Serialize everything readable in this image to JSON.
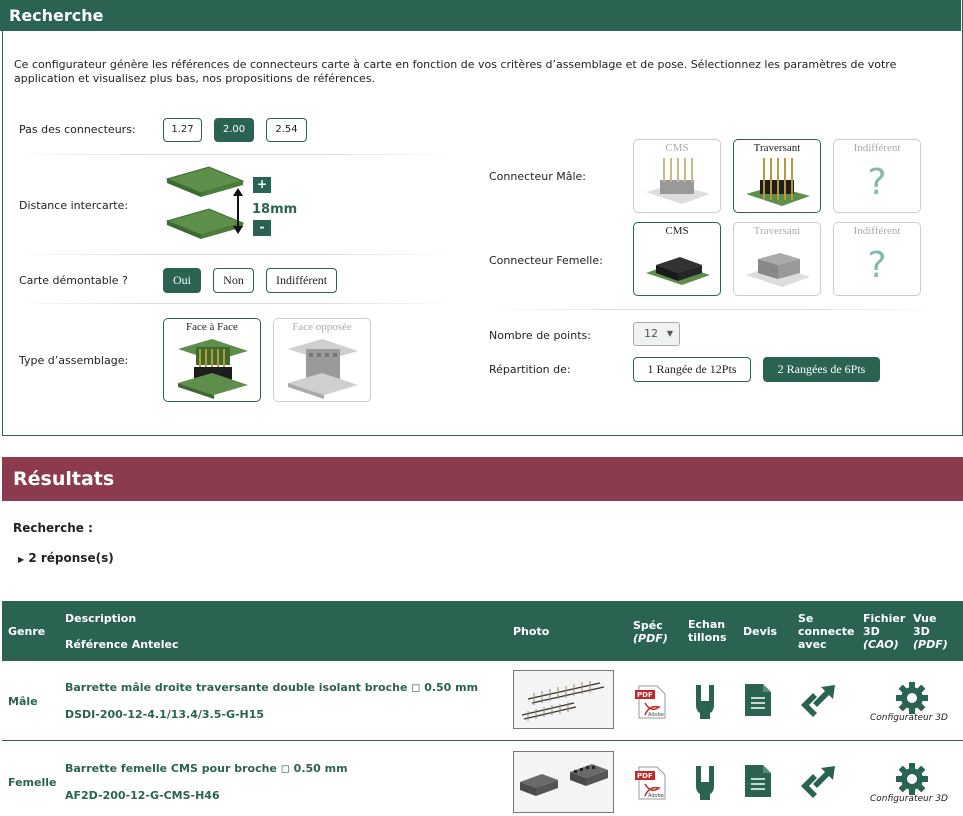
{
  "recherche": {
    "title": "Recherche",
    "intro": "Ce configurateur génère les références de connecteurs carte à carte en fonction de vos critères d’assemblage et de pose. Sélectionnez les paramètres de votre application et visualisez plus bas, nos propositions de références.",
    "pas": {
      "label": "Pas des connecteurs:",
      "options": [
        "1.27",
        "2.00",
        "2.54"
      ],
      "selected": "2.00"
    },
    "distance": {
      "label": "Distance intercarte:",
      "value": "18mm",
      "plus": "+",
      "minus": "-"
    },
    "demontable": {
      "label": "Carte démontable ?",
      "options": [
        "Oui",
        "Non",
        "Indifférent"
      ],
      "selected": "Oui"
    },
    "assemblage": {
      "label": "Type d’assemblage:",
      "options": [
        "Face à Face",
        "Face opposée"
      ],
      "selected": "Face à Face"
    },
    "male": {
      "label": "Connecteur Mâle:",
      "options": [
        "CMS",
        "Traversant",
        "Indifférent"
      ],
      "selected": "Traversant"
    },
    "femelle": {
      "label": "Connecteur Femelle:",
      "options": [
        "CMS",
        "Traversant",
        "Indifférent"
      ],
      "selected": "CMS"
    },
    "points": {
      "label": "Nombre de points:",
      "value": "12"
    },
    "repartition": {
      "label": "Répartition de:",
      "options": [
        "1 Rangée de 12Pts",
        "2 Rangées de 6Pts"
      ],
      "selected": "2 Rangées de 6Pts"
    },
    "question_mark": "?"
  },
  "resultats": {
    "title": "Résultats",
    "recherche_label": "Recherche :",
    "responses": "2 réponse(s)",
    "columns": {
      "genre": "Genre",
      "description": "Description",
      "reference": "Référence Antelec",
      "photo": "Photo",
      "spec": "Spéc",
      "spec_sub": "(PDF)",
      "echan": "Echan",
      "echan2": "tillons",
      "devis": "Devis",
      "connecte1": "Se",
      "connecte2": "connecte",
      "connecte3": "avec",
      "fichier1": "Fichier",
      "fichier2": "3D",
      "fichier3": "(CAO)",
      "vue1": "Vue",
      "vue2": "3D",
      "vue3": "(PDF)"
    },
    "rows": [
      {
        "genre": "Mâle",
        "description": "Barrette mâle droite traversante double isolant broche ◻ 0.50 mm",
        "reference": "DSDI-200-12-4.1/13.4/3.5-G-H15",
        "config_label": "Configurateur 3D"
      },
      {
        "genre": "Femelle",
        "description": "Barrette femelle CMS pour broche ◻ 0.50 mm",
        "reference": "AF2D-200-12-G-CMS-H46",
        "config_label": "Configurateur 3D"
      }
    ],
    "pdf_label": "PDF",
    "adobe_label": "Adobe"
  },
  "colors": {
    "green": "#2a6352",
    "bordeaux": "#8c3a4e",
    "question": "#87b8b0"
  }
}
